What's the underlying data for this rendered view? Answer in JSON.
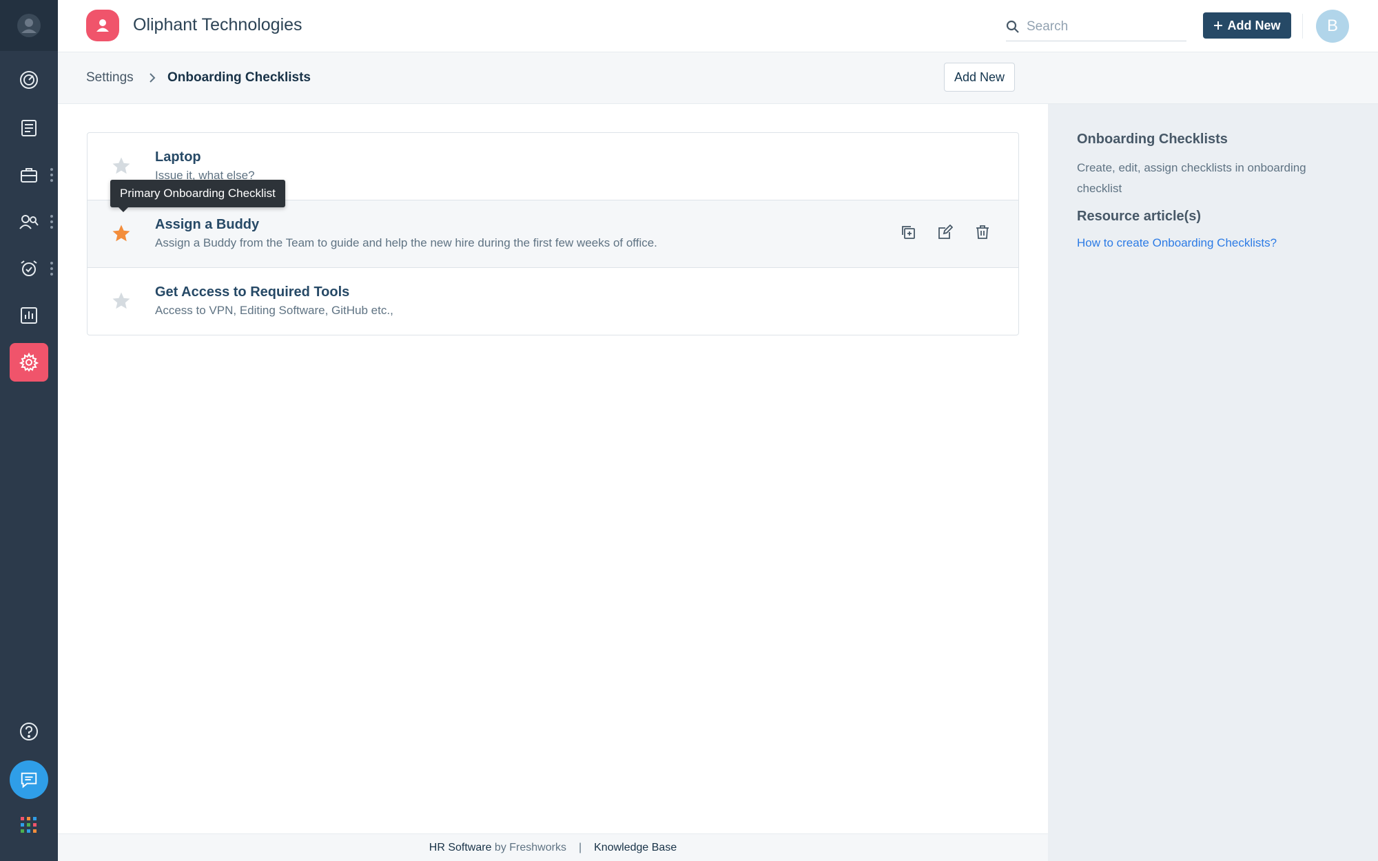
{
  "app": {
    "company_name": "Oliphant Technologies",
    "brand_color": "#f0546b",
    "avatar_initial": "B"
  },
  "header": {
    "search_placeholder": "Search",
    "add_new_label": "Add New"
  },
  "breadcrumb": {
    "parent": "Settings",
    "current": "Onboarding Checklists",
    "add_new_label": "Add New"
  },
  "sidebar": {
    "items": [
      {
        "icon": "dashboard-icon"
      },
      {
        "icon": "document-icon"
      },
      {
        "icon": "briefcase-icon"
      },
      {
        "icon": "people-icon"
      },
      {
        "icon": "alarm-icon"
      },
      {
        "icon": "reports-icon"
      },
      {
        "icon": "settings-icon",
        "active": true
      }
    ],
    "bottom": [
      {
        "icon": "help-icon"
      },
      {
        "icon": "chat-icon"
      },
      {
        "icon": "apps-grid-icon"
      }
    ]
  },
  "checklists": [
    {
      "title": "Laptop",
      "description": "Issue it, what else?",
      "primary": false
    },
    {
      "title": "Assign a Buddy",
      "description": "Assign a Buddy from the Team to guide and help the new hire during the first few weeks of office.",
      "primary": true
    },
    {
      "title": "Get Access to Required Tools",
      "description": "Access to VPN, Editing Software, GitHub etc.,",
      "primary": false
    }
  ],
  "tooltip": "Primary Onboarding Checklist",
  "help_panel": {
    "title": "Onboarding Checklists",
    "description": "Create, edit, assign checklists in onboarding checklist",
    "resources_title": "Resource article(s)",
    "link_text": "How to create Onboarding Checklists?"
  },
  "footer": {
    "product": "HR Software",
    "by": "by",
    "company": "Freshworks",
    "separator": "|",
    "knowledge_base": "Knowledge Base"
  },
  "colors": {
    "star_primary": "#f38d3b",
    "star_default": "#d5dbe0",
    "nav_dark": "#264966",
    "link": "#2c7be5"
  }
}
